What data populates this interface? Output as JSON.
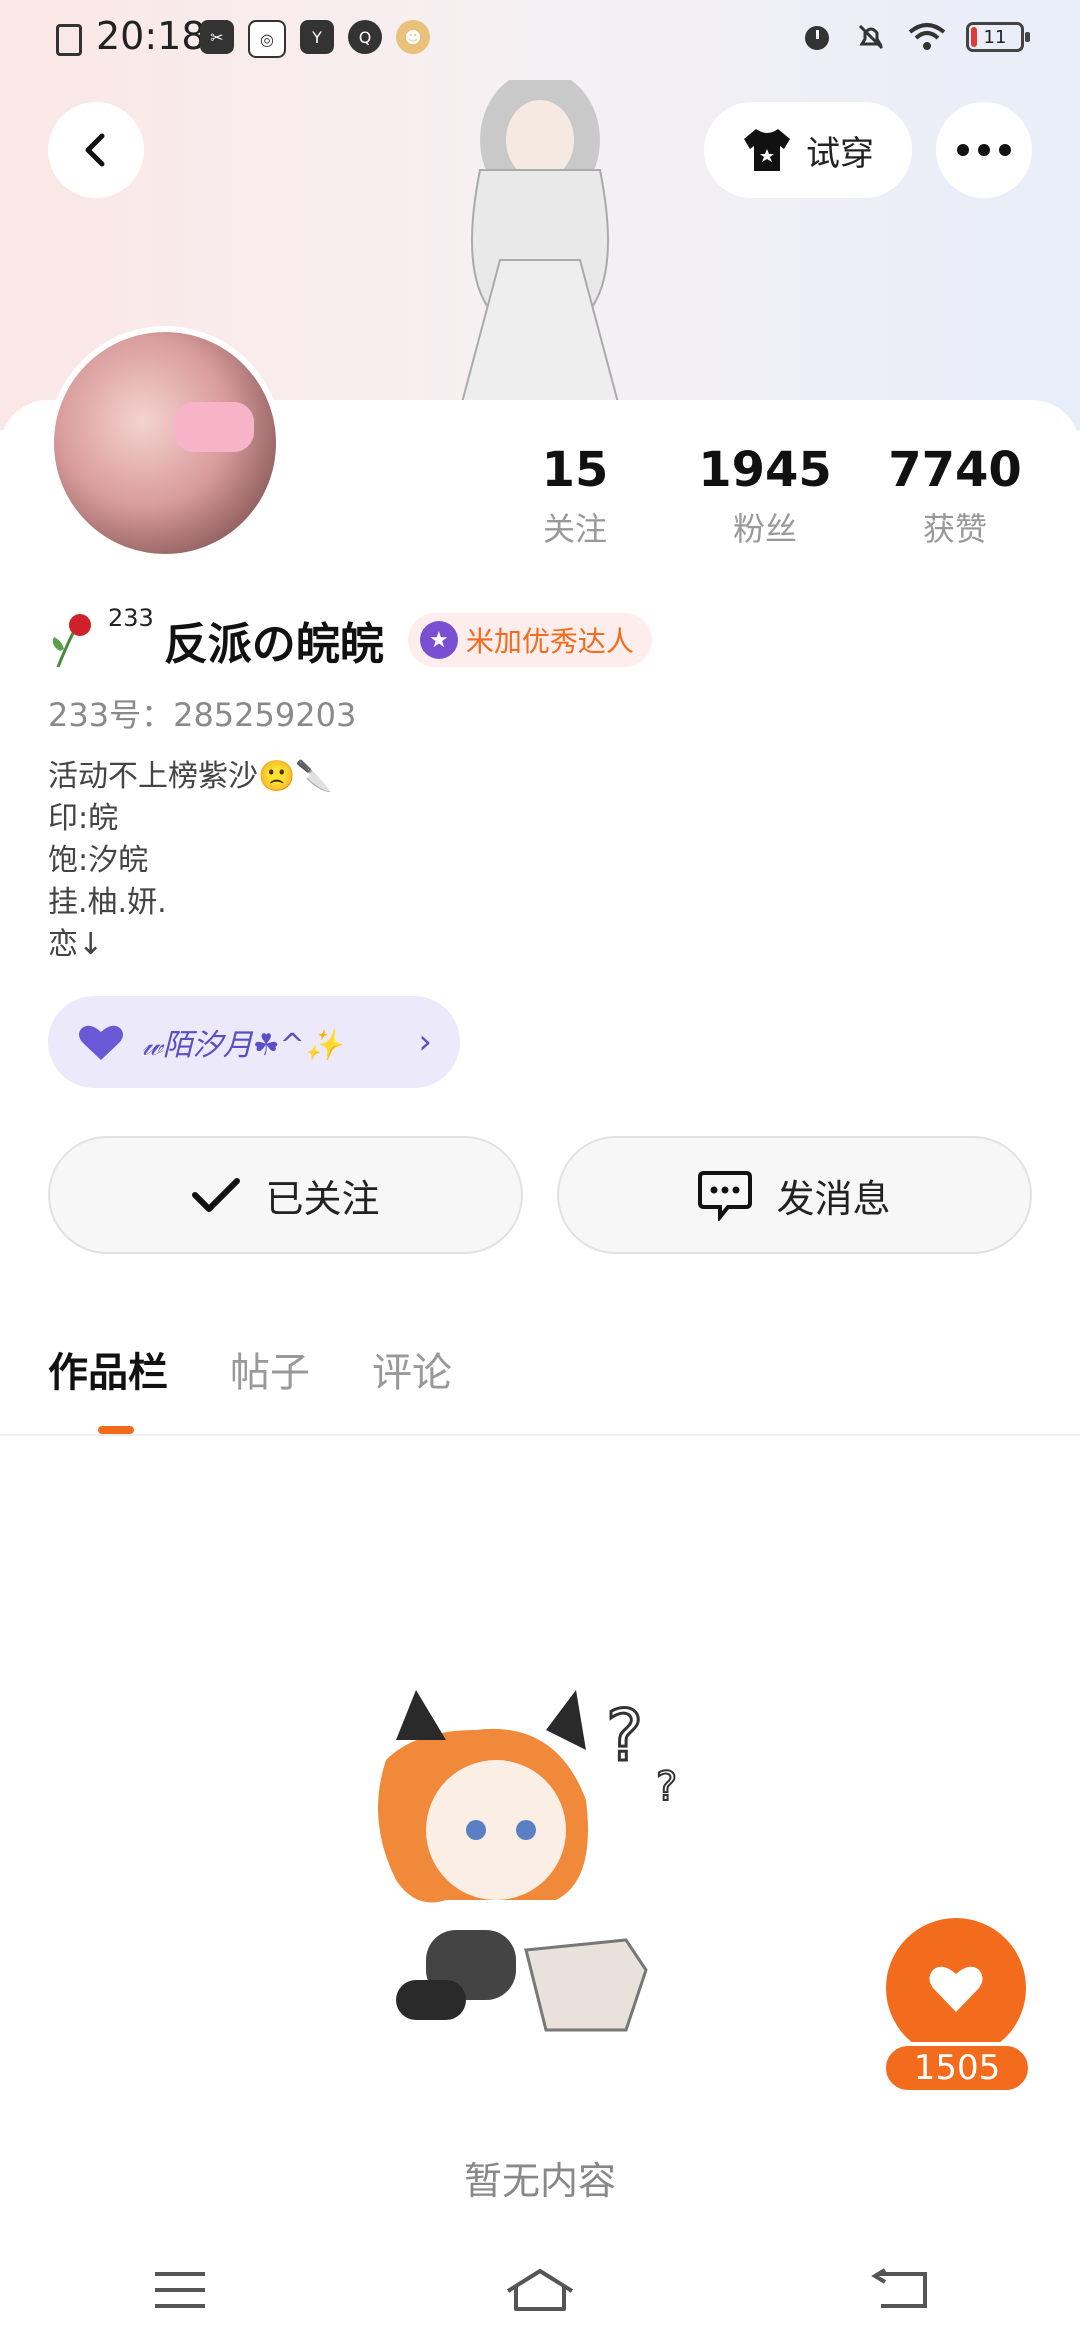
{
  "status_bar": {
    "time": "20:18",
    "app_icons": [
      "screenshot-icon",
      "scissors-icon",
      "qq-icon",
      "youku-icon",
      "browser-icon",
      "monkey-icon"
    ],
    "battery": "11"
  },
  "header": {
    "tryon_label": "试穿"
  },
  "stats": [
    {
      "value": "15",
      "label": "关注"
    },
    {
      "value": "1945",
      "label": "粉丝"
    },
    {
      "value": "7740",
      "label": "获赞"
    }
  ],
  "profile": {
    "badge_num": "233",
    "username": "反派の皖皖",
    "talent_badge": "米加优秀达人",
    "uid": "233号：285259203",
    "bio_lines": [
      "活动不上榜紫沙🙁🔪",
      "印:皖",
      "饱:汐皖",
      "挂.柚.妍.",
      "恋↓"
    ]
  },
  "group": {
    "name": "𝓌陌汐月☘^✨"
  },
  "actions": {
    "follow_label": "已关注",
    "message_label": "发消息"
  },
  "tabs": [
    {
      "label": "作品栏",
      "active": true
    },
    {
      "label": "帖子",
      "active": false
    },
    {
      "label": "评论",
      "active": false
    }
  ],
  "empty_text": "暂无内容",
  "like": {
    "count": "1505"
  },
  "colors": {
    "accent": "#f36b1c",
    "purple": "#5a4fc4"
  }
}
